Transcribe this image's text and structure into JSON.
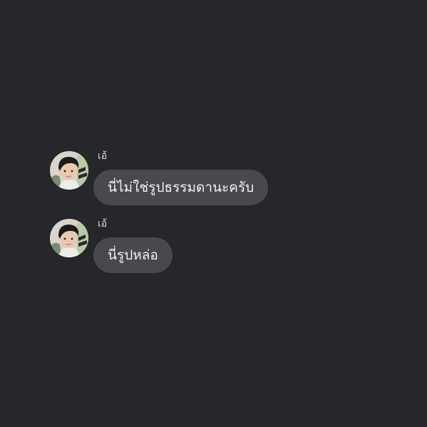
{
  "conversation": {
    "messages": [
      {
        "sender": "เอ้",
        "avatar_icon": "user-avatar-photo",
        "text": "นี่ไม่ใช่รูปธรรมดานะครับ"
      },
      {
        "sender": "เอ้",
        "avatar_icon": "user-avatar-photo",
        "text": "นี่รูปหล่อ"
      }
    ]
  },
  "colors": {
    "background": "#26272b",
    "bubble": "#48494e",
    "text": "#f2f2f4"
  }
}
